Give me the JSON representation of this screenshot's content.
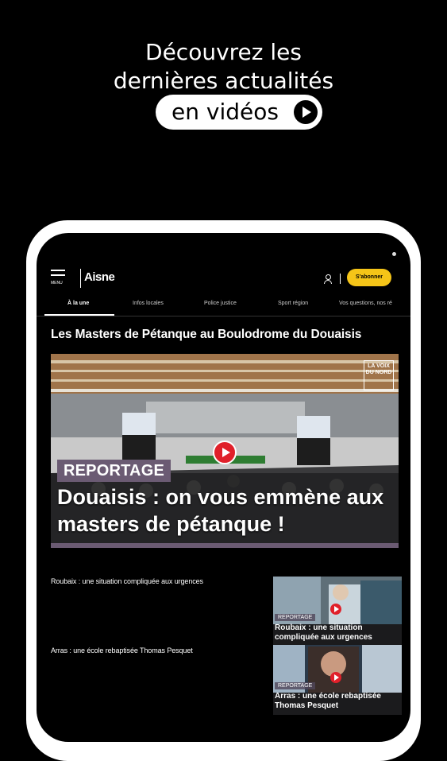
{
  "promo": {
    "line1": "Découvrez les",
    "line2": "dernières actualités",
    "pill_text": "en vidéos"
  },
  "app": {
    "menu_label": "MENU",
    "logo_text": "Aisne",
    "subscribe_label": "S'abonner",
    "tabs": [
      {
        "label": "À la une",
        "active": true
      },
      {
        "label": "Infos locales"
      },
      {
        "label": "Police justice"
      },
      {
        "label": "Sport région"
      },
      {
        "label": "Vos questions, nos ré"
      }
    ],
    "section_title": "Les Masters de Pétanque au Boulodrome du Douaisis",
    "hero": {
      "brand": "LA VOIX DU NORD",
      "tag": "REPORTAGE",
      "title": "Douaisis : on vous emmène aux masters de pétanque !"
    },
    "list": [
      {
        "text": "Roubaix : une situation compliquée aux urgences",
        "card_tag": "REPORTAGE",
        "card_title": "Roubaix : une situation compliquée aux urgences"
      },
      {
        "text": "Arras : une école rebaptisée Thomas Pesquet",
        "card_tag": "REPORTAGE",
        "card_title": "Arras : une école rebaptisée Thomas Pesquet"
      }
    ]
  },
  "colors": {
    "subscribe": "#f5c518",
    "tag": "#6b5b73",
    "play": "#e0202a"
  }
}
